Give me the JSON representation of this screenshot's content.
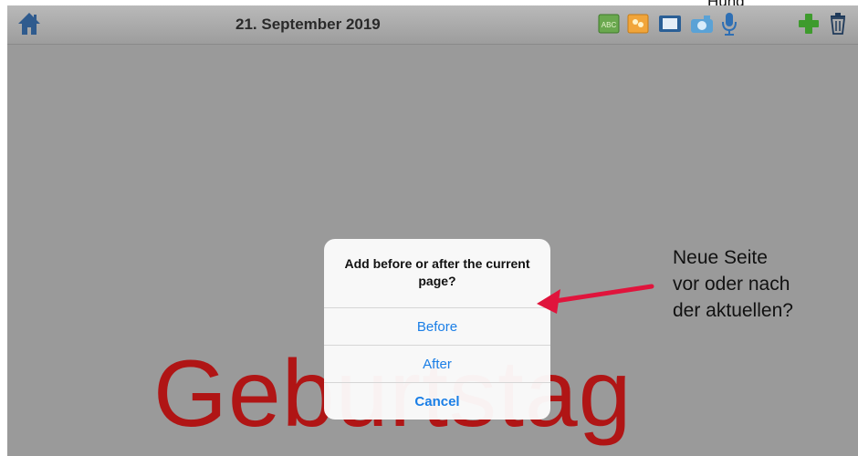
{
  "header": {
    "date": "21. September 2019",
    "stray_text": "Hünd",
    "toolbar_icons": [
      "text-abc-icon",
      "flower-sticker-icon",
      "film-icon",
      "camera-icon",
      "microphone-icon",
      "plus-icon",
      "trash-icon"
    ]
  },
  "page": {
    "title_word": "Geburtstag",
    "title_color": "#b01515"
  },
  "dialog": {
    "title": "Add before or after the current page?",
    "buttons": {
      "before": "Before",
      "after": "After",
      "cancel": "Cancel"
    },
    "button_color": "#1a7ee6"
  },
  "annotation": {
    "line1": "Neue Seite",
    "line2": "vor oder nach",
    "line3": "der aktuellen?",
    "arrow_color": "#e0143c"
  }
}
